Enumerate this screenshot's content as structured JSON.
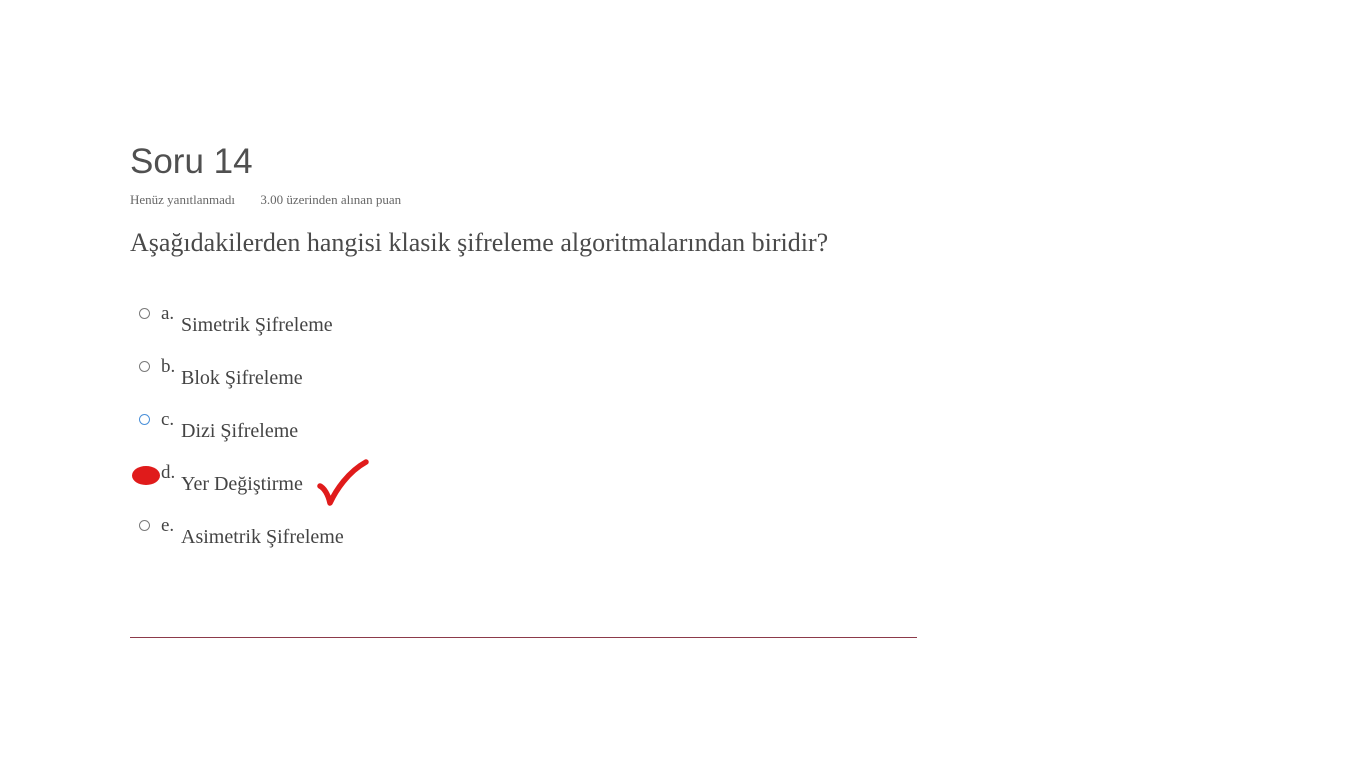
{
  "question": {
    "title": "Soru 14",
    "status": "Henüz yanıtlanmadı",
    "points": "3.00 üzerinden alınan puan",
    "text": "Aşağıdakilerden hangisi klasik şifreleme algoritmalarından biridir?"
  },
  "answers": [
    {
      "letter": "a.",
      "label": "Simetrik Şifreleme"
    },
    {
      "letter": "b.",
      "label": "Blok Şifreleme"
    },
    {
      "letter": "c.",
      "label": "Dizi Şifreleme"
    },
    {
      "letter": "d.",
      "label": "Yer Değiştirme"
    },
    {
      "letter": "e.",
      "label": "Asimetrik Şifreleme"
    }
  ],
  "colors": {
    "annotation": "#e01b1b",
    "divider": "#8c3a4a",
    "focus": "#4a90d9"
  },
  "annotations": {
    "marked_answer": "d",
    "icons": [
      "red-scribble-dot-icon",
      "red-checkmark-icon"
    ]
  }
}
